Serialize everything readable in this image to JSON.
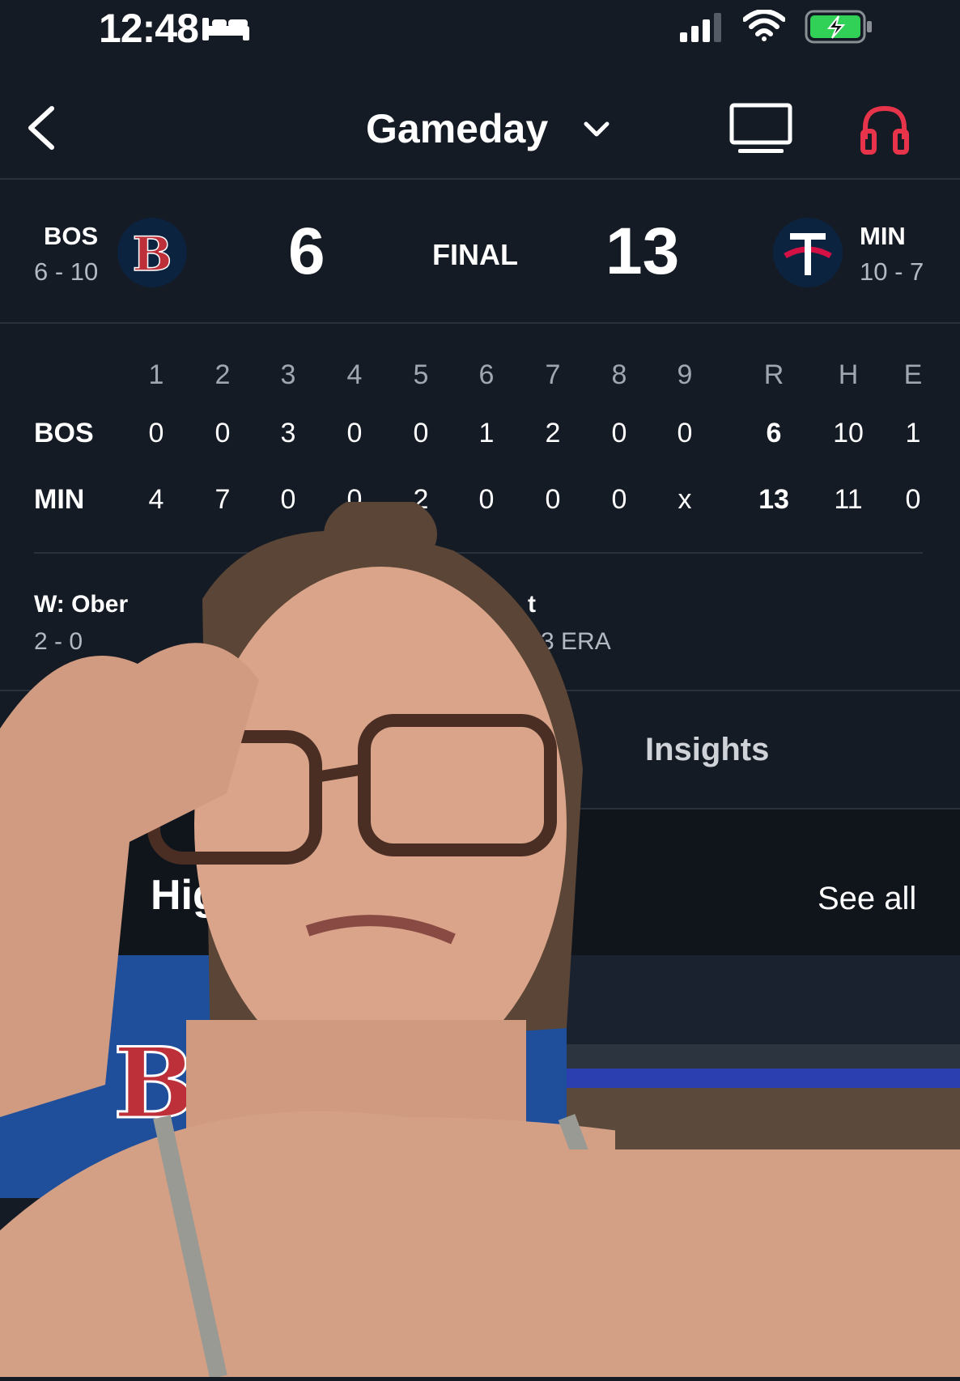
{
  "status_bar": {
    "time": "12:48"
  },
  "nav": {
    "title": "Gameday"
  },
  "away": {
    "abbr": "BOS",
    "record": "6 - 10",
    "score": "6"
  },
  "home": {
    "abbr": "MIN",
    "record": "10 - 7",
    "score": "13"
  },
  "game_status": "FINAL",
  "linescore": {
    "headers": [
      "1",
      "2",
      "3",
      "4",
      "5",
      "6",
      "7",
      "8",
      "9",
      "R",
      "H",
      "E"
    ],
    "rows": [
      {
        "team": "BOS",
        "cells": [
          "0",
          "0",
          "3",
          "0",
          "0",
          "1",
          "2",
          "0",
          "0",
          "6",
          "10",
          "1"
        ]
      },
      {
        "team": "MIN",
        "cells": [
          "4",
          "7",
          "0",
          "0",
          "2",
          "0",
          "0",
          "0",
          "x",
          "13",
          "11",
          "0"
        ]
      }
    ]
  },
  "decisions": {
    "win_label": "W: Ober",
    "win_record": "2 - 0",
    "loss_label_partial": "t",
    "loss_sub_partial": "3 ERA"
  },
  "tabs": {
    "insights": "Insights"
  },
  "highlights": {
    "title_partial": "Hig",
    "see_all": "See all"
  },
  "colors": {
    "accent_red": "#e8344a",
    "background": "#151b24",
    "divider": "#2a313c"
  }
}
